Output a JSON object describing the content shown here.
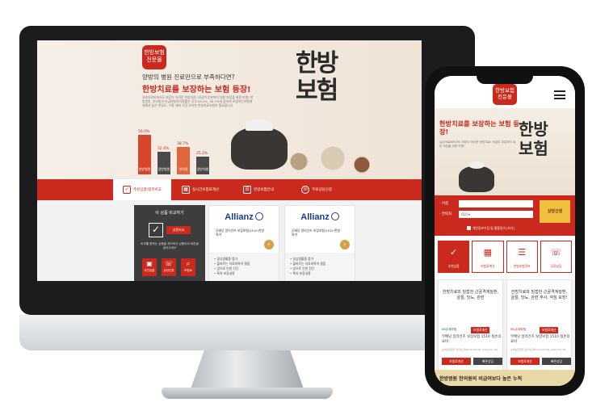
{
  "desktop": {
    "logo": "한방보험\n전문몰",
    "hero_question": "양방의 병원 진료만으로 부족하다면?",
    "hero_headline": "한방치료를 보장하는 보험 등장!",
    "hero_paragraph": "실손의료비에서도 보장이 어려운 한방치료! 비급여 부분까지 대한 보장을 위한 보험! 한방병원, 한의원의 비급여항목이용률은 각각 56.0%, 38.7%에 달하여 보장하는보험에 대해서 높은 관심도, 이용 대비 가장 유리한 한방치료보험이 필요합니다.",
    "calligraphy": [
      "한방",
      "보험"
    ],
    "chart_data": {
      "type": "bar",
      "categories": [
        "한방병원",
        "일반병원",
        "한의원",
        "일반의원"
      ],
      "values": [
        56.0,
        32.4,
        38.7,
        25.2
      ],
      "labels": [
        "56.0%",
        "32.4%",
        "38.7%",
        "25.2%"
      ],
      "colors": [
        "#d9452b",
        "#4a4a4a",
        "#e0663e",
        "#4a4a4a"
      ]
    },
    "nav": [
      {
        "label": "추천상품/항목비교",
        "icon": "✓"
      },
      {
        "label": "실시간보험료계산",
        "icon": "▦"
      },
      {
        "label": "한방보험안내",
        "icon": "☰"
      },
      {
        "label": "무료상담신청",
        "icon": "☏"
      }
    ],
    "compare": {
      "title": "이 상품 비교하기",
      "button": "상품비교",
      "text": "비교를 원하는 상품을 체크하고 상품비교 버튼을 눌러주세요",
      "icons": [
        {
          "label": "추천상품",
          "icon": "▣"
        },
        {
          "label": "상담신청",
          "icon": "☏"
        },
        {
          "label": "보험료",
          "icon": "⌕"
        }
      ]
    },
    "insurers": [
      {
        "brand": "Allianz",
        "product": "무배당 알리안츠 보장보험/1510 한방특약",
        "features": [
          "• 일상생활중 증가",
          "• 올바르는 치료비특약 결합",
          "• 암으로 인한 진단",
          "• 특약 보장내용"
        ]
      },
      {
        "brand": "Allianz",
        "product": "무배당 알리안츠 보장보험/1510 한방특약",
        "features": [
          "• 일상생활중 증가",
          "• 올바르는 치료비특약 결합",
          "• 암으로 인한 진단",
          "• 특약 보장내용"
        ]
      }
    ]
  },
  "phone": {
    "logo": "한방보험\n전문몰",
    "hero_headline": "한방치료를 보장하는 보험 등장!",
    "hero_paragraph": "실손의료비에서도 보장이 어려운 한방치료! 비급여 부분까지 대한 보장을 위한 보험!",
    "calligraphy": [
      "한방",
      "보험"
    ],
    "form": {
      "name_label": "· 이름",
      "phone_label": "· 연락처",
      "phone_prefix": "010 ▾",
      "agree": "개인정보수집 및 활용동의 [보기]",
      "submit": "상담신청"
    },
    "tabs": [
      {
        "label": "추천상품",
        "icon": "✓"
      },
      {
        "label": "보험료계산",
        "icon": "▦"
      },
      {
        "label": "한방보험정보",
        "icon": "☰"
      },
      {
        "label": "무료상담",
        "icon": "☏"
      }
    ],
    "cards": [
      {
        "title": "한방치료와 밀접한 근골격계질환, 골절, 당뇨, 관련",
        "badge": "보험료계산",
        "company": "KB손해보험",
        "product": "무배당 알리안츠 보장보험 1510 실손의료비",
        "meta": "손해보험협회 심의필 제2023-2034호 (2023.05.16)",
        "btn1": "보험료계산",
        "btn2": "빠른상담"
      },
      {
        "title": "한방치료와 밀접한 근골격계질환, 골절, 당뇨, 관련 주사, 약침 보장!",
        "badge": "보험료계산",
        "company": "MG손해보험",
        "product": "무배당 알리안츠 보장보험 1510 실손의료비",
        "meta": "손해보험협회 심의필 제2023-2034호 (2023.05.16)",
        "btn1": "보험료계산",
        "btn2": "빠른상담"
      }
    ],
    "footer": "한방병원 한의원의 비급여보다 높은 누적"
  }
}
